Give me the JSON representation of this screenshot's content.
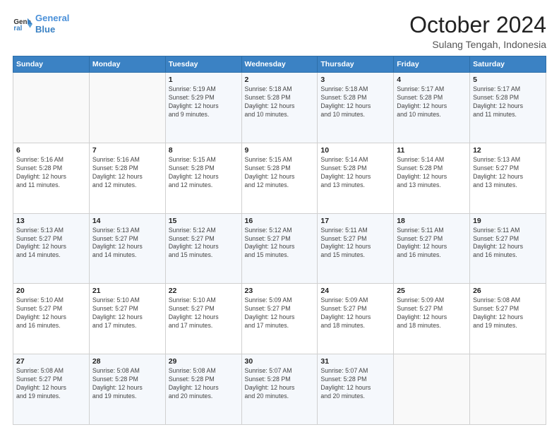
{
  "header": {
    "logo_line1": "General",
    "logo_line2": "Blue",
    "month": "October 2024",
    "location": "Sulang Tengah, Indonesia"
  },
  "weekdays": [
    "Sunday",
    "Monday",
    "Tuesday",
    "Wednesday",
    "Thursday",
    "Friday",
    "Saturday"
  ],
  "weeks": [
    [
      {
        "day": "",
        "info": ""
      },
      {
        "day": "",
        "info": ""
      },
      {
        "day": "1",
        "info": "Sunrise: 5:19 AM\nSunset: 5:29 PM\nDaylight: 12 hours\nand 9 minutes."
      },
      {
        "day": "2",
        "info": "Sunrise: 5:18 AM\nSunset: 5:28 PM\nDaylight: 12 hours\nand 10 minutes."
      },
      {
        "day": "3",
        "info": "Sunrise: 5:18 AM\nSunset: 5:28 PM\nDaylight: 12 hours\nand 10 minutes."
      },
      {
        "day": "4",
        "info": "Sunrise: 5:17 AM\nSunset: 5:28 PM\nDaylight: 12 hours\nand 10 minutes."
      },
      {
        "day": "5",
        "info": "Sunrise: 5:17 AM\nSunset: 5:28 PM\nDaylight: 12 hours\nand 11 minutes."
      }
    ],
    [
      {
        "day": "6",
        "info": "Sunrise: 5:16 AM\nSunset: 5:28 PM\nDaylight: 12 hours\nand 11 minutes."
      },
      {
        "day": "7",
        "info": "Sunrise: 5:16 AM\nSunset: 5:28 PM\nDaylight: 12 hours\nand 12 minutes."
      },
      {
        "day": "8",
        "info": "Sunrise: 5:15 AM\nSunset: 5:28 PM\nDaylight: 12 hours\nand 12 minutes."
      },
      {
        "day": "9",
        "info": "Sunrise: 5:15 AM\nSunset: 5:28 PM\nDaylight: 12 hours\nand 12 minutes."
      },
      {
        "day": "10",
        "info": "Sunrise: 5:14 AM\nSunset: 5:28 PM\nDaylight: 12 hours\nand 13 minutes."
      },
      {
        "day": "11",
        "info": "Sunrise: 5:14 AM\nSunset: 5:28 PM\nDaylight: 12 hours\nand 13 minutes."
      },
      {
        "day": "12",
        "info": "Sunrise: 5:13 AM\nSunset: 5:27 PM\nDaylight: 12 hours\nand 13 minutes."
      }
    ],
    [
      {
        "day": "13",
        "info": "Sunrise: 5:13 AM\nSunset: 5:27 PM\nDaylight: 12 hours\nand 14 minutes."
      },
      {
        "day": "14",
        "info": "Sunrise: 5:13 AM\nSunset: 5:27 PM\nDaylight: 12 hours\nand 14 minutes."
      },
      {
        "day": "15",
        "info": "Sunrise: 5:12 AM\nSunset: 5:27 PM\nDaylight: 12 hours\nand 15 minutes."
      },
      {
        "day": "16",
        "info": "Sunrise: 5:12 AM\nSunset: 5:27 PM\nDaylight: 12 hours\nand 15 minutes."
      },
      {
        "day": "17",
        "info": "Sunrise: 5:11 AM\nSunset: 5:27 PM\nDaylight: 12 hours\nand 15 minutes."
      },
      {
        "day": "18",
        "info": "Sunrise: 5:11 AM\nSunset: 5:27 PM\nDaylight: 12 hours\nand 16 minutes."
      },
      {
        "day": "19",
        "info": "Sunrise: 5:11 AM\nSunset: 5:27 PM\nDaylight: 12 hours\nand 16 minutes."
      }
    ],
    [
      {
        "day": "20",
        "info": "Sunrise: 5:10 AM\nSunset: 5:27 PM\nDaylight: 12 hours\nand 16 minutes."
      },
      {
        "day": "21",
        "info": "Sunrise: 5:10 AM\nSunset: 5:27 PM\nDaylight: 12 hours\nand 17 minutes."
      },
      {
        "day": "22",
        "info": "Sunrise: 5:10 AM\nSunset: 5:27 PM\nDaylight: 12 hours\nand 17 minutes."
      },
      {
        "day": "23",
        "info": "Sunrise: 5:09 AM\nSunset: 5:27 PM\nDaylight: 12 hours\nand 17 minutes."
      },
      {
        "day": "24",
        "info": "Sunrise: 5:09 AM\nSunset: 5:27 PM\nDaylight: 12 hours\nand 18 minutes."
      },
      {
        "day": "25",
        "info": "Sunrise: 5:09 AM\nSunset: 5:27 PM\nDaylight: 12 hours\nand 18 minutes."
      },
      {
        "day": "26",
        "info": "Sunrise: 5:08 AM\nSunset: 5:27 PM\nDaylight: 12 hours\nand 19 minutes."
      }
    ],
    [
      {
        "day": "27",
        "info": "Sunrise: 5:08 AM\nSunset: 5:27 PM\nDaylight: 12 hours\nand 19 minutes."
      },
      {
        "day": "28",
        "info": "Sunrise: 5:08 AM\nSunset: 5:28 PM\nDaylight: 12 hours\nand 19 minutes."
      },
      {
        "day": "29",
        "info": "Sunrise: 5:08 AM\nSunset: 5:28 PM\nDaylight: 12 hours\nand 20 minutes."
      },
      {
        "day": "30",
        "info": "Sunrise: 5:07 AM\nSunset: 5:28 PM\nDaylight: 12 hours\nand 20 minutes."
      },
      {
        "day": "31",
        "info": "Sunrise: 5:07 AM\nSunset: 5:28 PM\nDaylight: 12 hours\nand 20 minutes."
      },
      {
        "day": "",
        "info": ""
      },
      {
        "day": "",
        "info": ""
      }
    ]
  ]
}
